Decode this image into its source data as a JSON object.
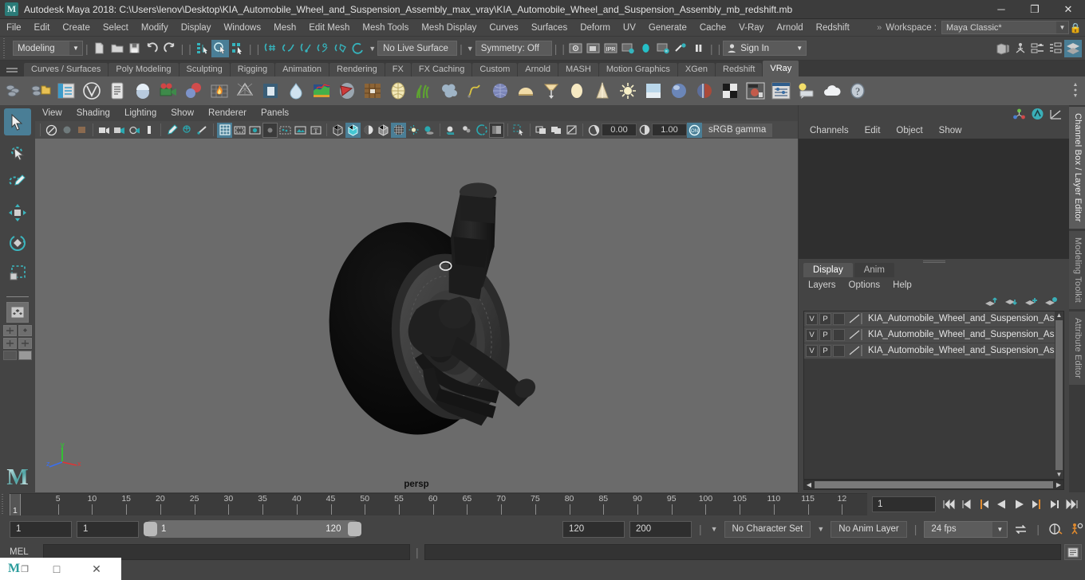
{
  "titlebar": {
    "app_icon": "maya-logo-icon",
    "title": "Autodesk Maya 2018: C:\\Users\\lenov\\Desktop\\KIA_Automobile_Wheel_and_Suspension_Assembly_max_vray\\KIA_Automobile_Wheel_and_Suspension_Assembly_mb_redshift.mb",
    "minimize": "─",
    "maximize": "❐",
    "close": "✕"
  },
  "menubar": {
    "items": [
      "File",
      "Edit",
      "Create",
      "Select",
      "Modify",
      "Display",
      "Windows",
      "Mesh",
      "Edit Mesh",
      "Mesh Tools",
      "Mesh Display",
      "Curves",
      "Surfaces",
      "Deform",
      "UV",
      "Generate",
      "Cache",
      "V-Ray",
      "Arnold",
      "Redshift"
    ],
    "overflow_icon": "»",
    "workspace_label": "Workspace :",
    "workspace_value": "Maya Classic*",
    "lock_icon": "lock-icon"
  },
  "statusbar": {
    "mode_value": "Modeling",
    "live_surface": "No Live Surface",
    "symmetry": "Symmetry: Off",
    "signin": "Sign In",
    "icons": [
      "new-scene-icon",
      "open-scene-icon",
      "save-scene-icon",
      "undo-icon",
      "redo-icon",
      "select-hierarchy-icon",
      "select-object-icon",
      "select-component-icon",
      "snap-grid-icon",
      "snap-curve-icon",
      "snap-point-icon",
      "snap-projected-icon",
      "snap-view-plane-icon",
      "make-live-icon",
      "render-view-icon",
      "render-region-icon",
      "ipr-render-icon",
      "render-settings-icon",
      "hypershade-icon",
      "render-sequence-icon",
      "render-diagnostics-icon",
      "pause-render-icon",
      "outliner-icon",
      "hypergraph-icon",
      "attribute-editor-icon",
      "channel-box-icon",
      "show-hide-editors-icon"
    ]
  },
  "shelf": {
    "tabs": [
      "Curves / Surfaces",
      "Poly Modeling",
      "Sculpting",
      "Rigging",
      "Animation",
      "Rendering",
      "FX",
      "FX Caching",
      "Custom",
      "Arnold",
      "MASH",
      "Motion Graphics",
      "XGen",
      "Redshift",
      "VRay"
    ],
    "active_tab": "VRay",
    "icons": [
      "vray-save-icon",
      "vray-save-folder-icon",
      "vray-render-settings-icon",
      "vray-logo-icon",
      "vray-scene-icon",
      "vray-material-icon",
      "vray-camera-icon",
      "vray-sphere-fade-icon",
      "vray-fire-volume-icon",
      "vray-mesh-light-icon",
      "vray-plane-icon",
      "vray-water-icon",
      "vray-environment-fog-icon",
      "vray-clipper-icon",
      "vray-displacement-icon",
      "vray-dome-light-icon",
      "vray-grass-icon",
      "vray-fur-icon",
      "vray-particle-icon",
      "vray-sphere-light-icon",
      "vray-dome-icon",
      "vray-ies-light-icon",
      "vray-area-light-icon",
      "vray-cone-light-icon",
      "vray-sun-icon",
      "vray-sky-icon",
      "vray-material-ball-icon",
      "vray-blend-material-icon",
      "vray-checker-icon",
      "vray-frame-buffer-icon",
      "vray-settings-panel-icon",
      "vray-tooltip-icon",
      "vray-cloud-icon",
      "vray-help-icon"
    ]
  },
  "toolbox": {
    "tools": [
      "select-tool",
      "lasso-select-tool",
      "paint-select-tool",
      "move-tool",
      "rotate-tool",
      "scale-tool"
    ],
    "active_tool": "select-tool",
    "layout_buttons": [
      "single-perspective-layout-icon",
      "four-view-layout-icon",
      "outliner-persp-layout-icon",
      "hypershade-persp-layout-icon"
    ],
    "logo": "M"
  },
  "viewport": {
    "menus": [
      "View",
      "Shading",
      "Lighting",
      "Show",
      "Renderer",
      "Panels"
    ],
    "exposure_value": "0.00",
    "gamma_value": "1.00",
    "color_space": "sRGB gamma",
    "camera_label": "persp",
    "axis": {
      "x": "x",
      "y": "y",
      "z": "z"
    },
    "toolbar_icons": [
      "select-camera-icon",
      "lock-camera-icon",
      "camera-attributes-icon",
      "bookmark-icon",
      "image-plane-icon",
      "two-d-pan-zoom-icon",
      "grease-pencil-icon",
      "grid-icon",
      "film-gate-icon",
      "resolution-gate-icon",
      "gate-mask-icon",
      "film-origin-icon",
      "safe-action-icon",
      "text-overlay-icon",
      "wireframe-icon",
      "smooth-shade-all-icon",
      "smooth-shade-selected-icon",
      "flat-shade-icon",
      "textured-icon",
      "lighting-icon",
      "shadows-icon",
      "ao-icon",
      "motion-blur-icon",
      "multisample-icon",
      "xray-icon",
      "xray-joints-icon",
      "isolate-select-icon",
      "viewport-exposure-icon",
      "viewport-gamma-icon",
      "color-management-toggle-icon"
    ]
  },
  "channel_box": {
    "top_icons": [
      "show-manipulator-icon",
      "attribute-editor-toggle-icon",
      "graph-editor-icon"
    ],
    "menus": [
      "Channels",
      "Edit",
      "Object",
      "Show"
    ]
  },
  "layer_editor": {
    "tabs": [
      "Display",
      "Anim"
    ],
    "active_tab": "Display",
    "menus": [
      "Layers",
      "Options",
      "Help"
    ],
    "buttons": [
      "move-layer-up-icon",
      "move-layer-down-icon",
      "new-layer-icon",
      "new-layer-from-selected-icon"
    ],
    "columns": [
      "V",
      "P"
    ],
    "layers": [
      {
        "visible": "V",
        "playback": "P",
        "name": "KIA_Automobile_Wheel_and_Suspension_Assembly"
      },
      {
        "visible": "V",
        "playback": "P",
        "name": "KIA_Automobile_Wheel_and_Suspension_Assembly"
      },
      {
        "visible": "V",
        "playback": "P",
        "name": "KIA_Automobile_Wheel_and_Suspension_Assembly"
      }
    ]
  },
  "right_tabs": {
    "items": [
      "Channel Box / Layer Editor",
      "Modeling Toolkit",
      "Attribute Editor"
    ],
    "active": "Channel Box / Layer Editor"
  },
  "timeslider": {
    "current_frame": "1",
    "frame_field": "1",
    "tick_labels": [
      "5",
      "10",
      "15",
      "20",
      "25",
      "30",
      "35",
      "40",
      "45",
      "50",
      "55",
      "60",
      "65",
      "70",
      "75",
      "80",
      "85",
      "90",
      "95",
      "100",
      "105",
      "110",
      "115",
      "12"
    ],
    "playback_buttons": [
      "go-to-start-icon",
      "step-back-frame-icon",
      "step-back-key-icon",
      "play-backwards-icon",
      "play-forwards-icon",
      "step-forward-key-icon",
      "step-forward-frame-icon",
      "go-to-end-icon"
    ]
  },
  "rangeslider": {
    "anim_start": "1",
    "playback_start": "1",
    "range_start": "1",
    "range_end": "120",
    "playback_end": "120",
    "anim_end": "200",
    "character_set": "No Character Set",
    "anim_layer": "No Anim Layer",
    "fps": "24 fps",
    "buttons": [
      "auto-keyframe-icon",
      "animation-preferences-icon",
      "playback-loop-icon"
    ]
  },
  "commandline": {
    "mel_label": "MEL",
    "input_value": "",
    "script_editor_icon": "script-editor-icon"
  },
  "taskbar": {
    "app_icon": "maya-taskbar-icon",
    "restore": "❐",
    "minimize": "□",
    "close": "✕"
  }
}
